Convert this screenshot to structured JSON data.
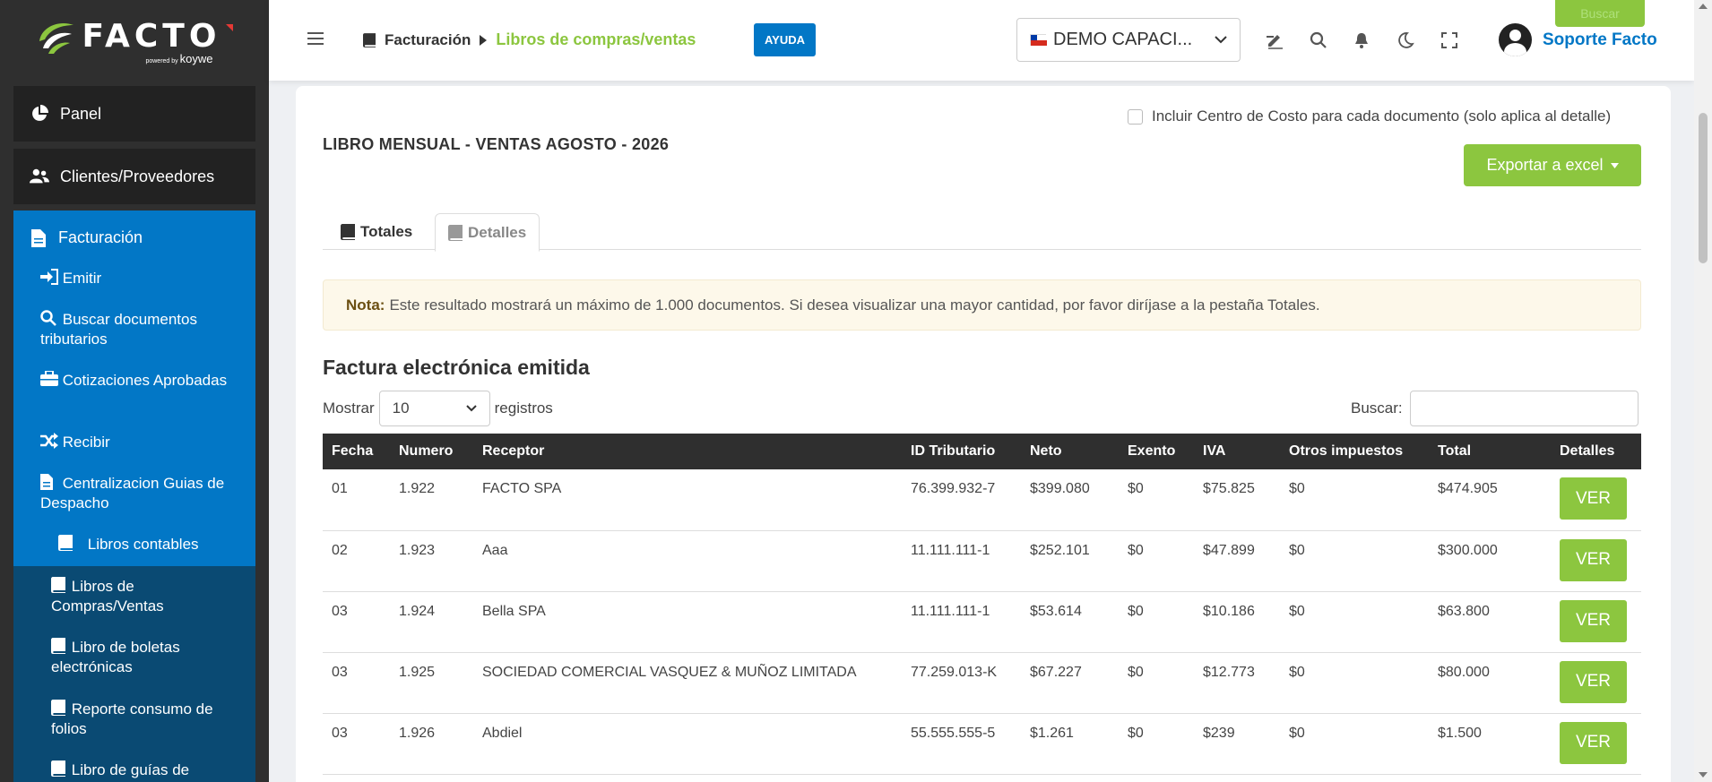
{
  "logo": {
    "name": "FACTO",
    "powered": "powered by",
    "brand": "koywe"
  },
  "sidebar": {
    "panel": "Panel",
    "clientes": "Clientes/Proveedores",
    "facturacion": "Facturación",
    "items": [
      {
        "label": "Emitir",
        "icon": "sign-in-icon"
      },
      {
        "label": "Buscar documentos tributarios",
        "icon": "search-icon"
      },
      {
        "label": "Cotizaciones Aprobadas",
        "icon": "briefcase-icon"
      },
      {
        "label": "Recibir",
        "icon": "shuffle-icon"
      },
      {
        "label": "Centralizacion Guias de Despacho",
        "icon": "file-icon"
      },
      {
        "label": "Libros contables",
        "icon": "book-icon"
      }
    ],
    "libros": [
      {
        "label": "Libros de Compras/Ventas",
        "icon": "book-icon"
      },
      {
        "label": "Libro de boletas electrónicas",
        "icon": "book-icon"
      },
      {
        "label": "Reporte consumo de folios",
        "icon": "book-icon"
      },
      {
        "label": "Libro de guías de",
        "icon": "book-icon"
      }
    ]
  },
  "topbar": {
    "crumb_parent": "Facturación",
    "crumb_current": "Libros de compras/ventas",
    "ayuda": "AYUDA",
    "company": "DEMO CAPACI...",
    "user": "Soporte Facto",
    "buscar": "Buscar"
  },
  "card": {
    "checkbox_label": "Incluir Centro de Costo para cada documento (solo aplica al detalle)",
    "title": "LIBRO MENSUAL - VENTAS AGOSTO - 2026",
    "export": "Exportar a excel",
    "tab_totales": "Totales",
    "tab_detalles": "Detalles",
    "note_label": "Nota:",
    "note_text": "Este resultado mostrará un máximo de 1.000 documentos. Si desea visualizar una mayor cantidad, por favor diríjase a la pestaña Totales.",
    "section_title": "Factura electrónica emitida",
    "mostrar": "Mostrar",
    "page_size": "10",
    "registros": "registros",
    "buscar": "Buscar:"
  },
  "table": {
    "headers": [
      "Fecha",
      "Numero",
      "Receptor",
      "ID Tributario",
      "Neto",
      "Exento",
      "IVA",
      "Otros impuestos",
      "Total",
      "Detalles"
    ],
    "rows": [
      [
        "01",
        "1.922",
        "FACTO SPA",
        "76.399.932-7",
        "$399.080",
        "$0",
        "$75.825",
        "$0",
        "$474.905"
      ],
      [
        "02",
        "1.923",
        "Aaa",
        "11.111.111-1",
        "$252.101",
        "$0",
        "$47.899",
        "$0",
        "$300.000"
      ],
      [
        "03",
        "1.924",
        "Bella SPA",
        "11.111.111-1",
        "$53.614",
        "$0",
        "$10.186",
        "$0",
        "$63.800"
      ],
      [
        "03",
        "1.925",
        "SOCIEDAD COMERCIAL VASQUEZ & MUÑOZ LIMITADA",
        "77.259.013-K",
        "$67.227",
        "$0",
        "$12.773",
        "$0",
        "$80.000"
      ],
      [
        "03",
        "1.926",
        "Abdiel",
        "55.555.555-5",
        "$1.261",
        "$0",
        "$239",
        "$0",
        "$1.500"
      ]
    ],
    "ver": "VER"
  },
  "colors": {
    "green": "#8cc63f",
    "blue": "#0277c6",
    "dark": "#2f2f2f"
  }
}
